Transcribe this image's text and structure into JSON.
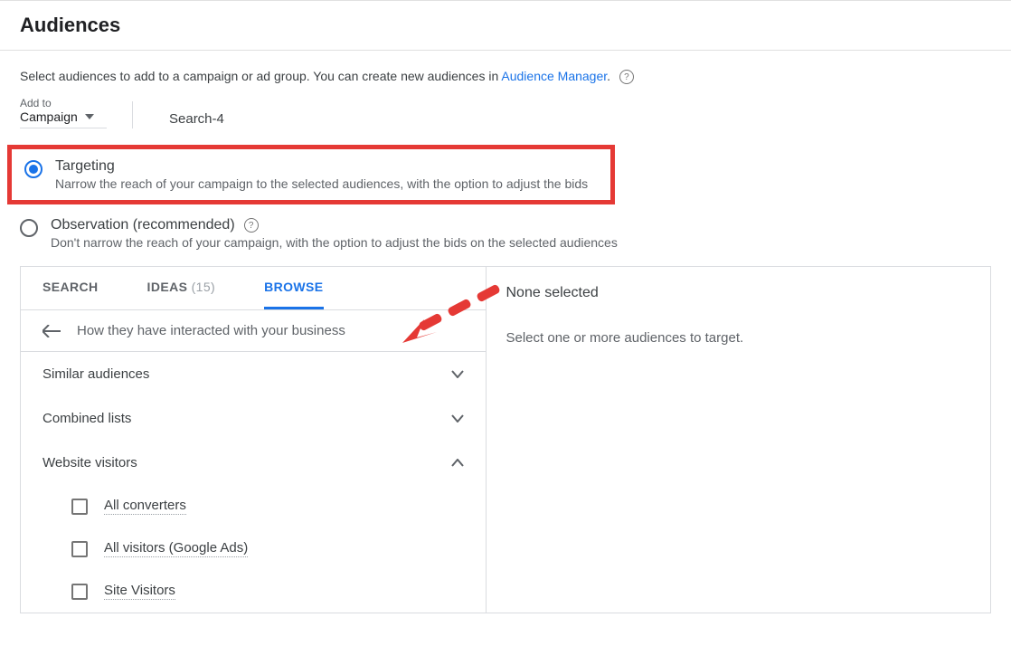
{
  "header": {
    "title": "Audiences"
  },
  "intro": {
    "text_before": "Select audiences to add to a campaign or ad group. You can create new audiences in ",
    "link_text": "Audience Manager",
    "text_after": "."
  },
  "addto": {
    "label": "Add to",
    "value": "Campaign"
  },
  "campaign_name": "Search-4",
  "radios": {
    "targeting": {
      "title": "Targeting",
      "desc": "Narrow the reach of your campaign to the selected audiences, with the option to adjust the bids"
    },
    "observation": {
      "title": "Observation (recommended)",
      "desc": "Don't narrow the reach of your campaign, with the option to adjust the bids on the selected audiences"
    }
  },
  "tabs": {
    "search": "SEARCH",
    "ideas_label": "IDEAS",
    "ideas_count": "(15)",
    "browse": "BROWSE"
  },
  "crumb_label": "How they have interacted with your business",
  "rows": {
    "similar": "Similar audiences",
    "combined": "Combined lists",
    "visitors": "Website visitors"
  },
  "visitor_items": [
    "All converters",
    "All visitors (Google Ads)",
    "Site Visitors"
  ],
  "right": {
    "title": "None selected",
    "desc": "Select one or more audiences to target."
  }
}
